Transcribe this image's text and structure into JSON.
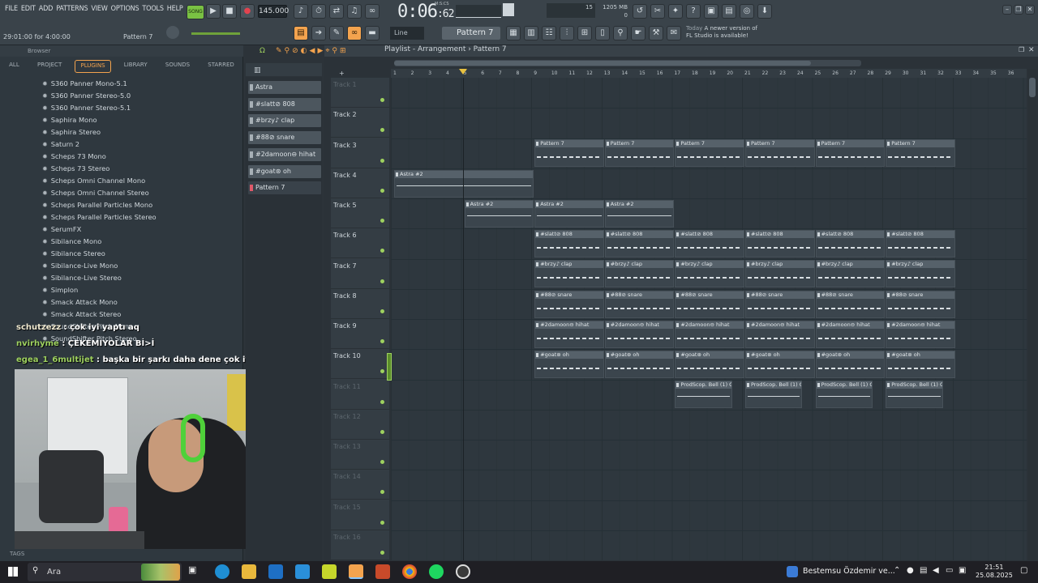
{
  "menu": [
    "FILE",
    "EDIT",
    "ADD",
    "PATTERNS",
    "VIEW",
    "OPTIONS",
    "TOOLS",
    "HELP"
  ],
  "toolbar": {
    "song_label": "SONG",
    "bpm": "145.000",
    "time_main": "0:06",
    "time_sub": ":62",
    "mics_label": "M:S:CS",
    "cpu": "15",
    "memory": "1205 MB",
    "memory2": "0",
    "hint_left": "29:01:00 for 4:00:00",
    "hint_right": "Pattern 7",
    "snap": "Line",
    "pattern": "Pattern 7",
    "news_title": "Today",
    "news_line1": "A newer version of",
    "news_line2": "FL Studio is available!"
  },
  "browser": {
    "title": "Browser",
    "tabs": [
      "ALL",
      "PROJECT",
      "PLUGINS",
      "LIBRARY",
      "SOUNDS",
      "STARRED"
    ],
    "active_tab": "PLUGINS",
    "plugins": [
      "S360 Panner Mono-5.1",
      "S360 Panner Stereo-5.0",
      "S360 Panner Stereo-5.1",
      "Saphira Mono",
      "Saphira Stereo",
      "Saturn 2",
      "Scheps 73 Mono",
      "Scheps 73 Stereo",
      "Scheps Omni Channel Mono",
      "Scheps Omni Channel Stereo",
      "Scheps Parallel Particles Mono",
      "Scheps Parallel Particles Stereo",
      "SerumFX",
      "Sibilance Mono",
      "Sibilance Stereo",
      "Sibilance-Live Mono",
      "Sibilance-Live Stereo",
      "Simplon",
      "Smack Attack Mono",
      "Smack Attack Stereo",
      "SoundShifter Pitch Mono",
      "SoundShifter Pitch Stereo"
    ],
    "tags_label": "TAGS"
  },
  "chat": [
    {
      "user": "schutzezz",
      "msg": " : çok iyi yaptı aq"
    },
    {
      "user": "nvirhyme",
      "msg": " : ÇEKEMIYOLAR Bİ>İ"
    },
    {
      "user": "egea_1_6multijet",
      "msg": " : başka bir şarkı daha dene çok iyi oluyo"
    }
  ],
  "patterns": [
    "Astra",
    "#slatt⊘ 808",
    "#brzy♪ clap",
    "#88⊘ snare",
    "#2damoon⊖ hihat",
    "#goat⊛ oh",
    "Pattern 7"
  ],
  "playlist": {
    "title": "Playlist - Arrangement › Pattern 7",
    "tracks": [
      "Track 1",
      "Track 2",
      "Track 3",
      "Track 4",
      "Track 5",
      "Track 6",
      "Track 7",
      "Track 8",
      "Track 9",
      "Track 10",
      "Track 11",
      "Track 12",
      "Track 13",
      "Track 14",
      "Track 15",
      "Track 16"
    ],
    "bars": [
      "1",
      "2",
      "3",
      "4",
      "5",
      "6",
      "7",
      "8",
      "9",
      "10",
      "11",
      "12",
      "13",
      "14",
      "15",
      "16",
      "17",
      "18",
      "19",
      "20",
      "21",
      "22",
      "23",
      "24",
      "25",
      "26",
      "27",
      "28",
      "29",
      "30",
      "31",
      "32",
      "33",
      "34",
      "35",
      "36"
    ],
    "clips": [
      {
        "label": "Pattern 7",
        "track": 2,
        "bar": 9,
        "len": 4
      },
      {
        "label": "Pattern 7",
        "track": 2,
        "bar": 13,
        "len": 4
      },
      {
        "label": "Pattern 7",
        "track": 2,
        "bar": 17,
        "len": 4
      },
      {
        "label": "Pattern 7",
        "track": 2,
        "bar": 21,
        "len": 4
      },
      {
        "label": "Pattern 7",
        "track": 2,
        "bar": 25,
        "len": 4
      },
      {
        "label": "Pattern 7",
        "track": 2,
        "bar": 29,
        "len": 4
      },
      {
        "label": "Astra #2",
        "track": 3,
        "bar": 1,
        "len": 8,
        "audio": true
      },
      {
        "label": "Astra #2",
        "track": 4,
        "bar": 5,
        "len": 4,
        "audio": true
      },
      {
        "label": "Astra #2",
        "track": 4,
        "bar": 9,
        "len": 4,
        "audio": true
      },
      {
        "label": "Astra #2",
        "track": 4,
        "bar": 13,
        "len": 4,
        "audio": true
      },
      {
        "label": "#slatt⊘ 808",
        "track": 5,
        "bar": 9,
        "len": 4
      },
      {
        "label": "#slatt⊘ 808",
        "track": 5,
        "bar": 13,
        "len": 4
      },
      {
        "label": "#slatt⊘ 808",
        "track": 5,
        "bar": 17,
        "len": 4
      },
      {
        "label": "#slatt⊘ 808",
        "track": 5,
        "bar": 21,
        "len": 4
      },
      {
        "label": "#slatt⊘ 808",
        "track": 5,
        "bar": 25,
        "len": 4
      },
      {
        "label": "#slatt⊘ 808",
        "track": 5,
        "bar": 29,
        "len": 4
      },
      {
        "label": "#brzy♪ clap",
        "track": 6,
        "bar": 9,
        "len": 4
      },
      {
        "label": "#brzy♪ clap",
        "track": 6,
        "bar": 13,
        "len": 4
      },
      {
        "label": "#brzy♪ clap",
        "track": 6,
        "bar": 17,
        "len": 4
      },
      {
        "label": "#brzy♪ clap",
        "track": 6,
        "bar": 21,
        "len": 4
      },
      {
        "label": "#brzy♪ clap",
        "track": 6,
        "bar": 25,
        "len": 4
      },
      {
        "label": "#brzy♪ clap",
        "track": 6,
        "bar": 29,
        "len": 4
      },
      {
        "label": "#88⊘ snare",
        "track": 7,
        "bar": 9,
        "len": 4
      },
      {
        "label": "#88⊘ snare",
        "track": 7,
        "bar": 13,
        "len": 4
      },
      {
        "label": "#88⊘ snare",
        "track": 7,
        "bar": 17,
        "len": 4
      },
      {
        "label": "#88⊘ snare",
        "track": 7,
        "bar": 21,
        "len": 4
      },
      {
        "label": "#88⊘ snare",
        "track": 7,
        "bar": 25,
        "len": 4
      },
      {
        "label": "#88⊘ snare",
        "track": 7,
        "bar": 29,
        "len": 4
      },
      {
        "label": "#2damoon⊖ hihat",
        "track": 8,
        "bar": 9,
        "len": 4
      },
      {
        "label": "#2damoon⊖ hihat",
        "track": 8,
        "bar": 13,
        "len": 4
      },
      {
        "label": "#2damoon⊖ hihat",
        "track": 8,
        "bar": 17,
        "len": 4
      },
      {
        "label": "#2damoon⊖ hihat",
        "track": 8,
        "bar": 21,
        "len": 4
      },
      {
        "label": "#2damoon⊖ hihat",
        "track": 8,
        "bar": 25,
        "len": 4
      },
      {
        "label": "#2damoon⊖ hihat",
        "track": 8,
        "bar": 29,
        "len": 4
      },
      {
        "label": "#goat⊛ oh",
        "track": 9,
        "bar": 9,
        "len": 4
      },
      {
        "label": "#goat⊛ oh",
        "track": 9,
        "bar": 13,
        "len": 4
      },
      {
        "label": "#goat⊛ oh",
        "track": 9,
        "bar": 17,
        "len": 4
      },
      {
        "label": "#goat⊛ oh",
        "track": 9,
        "bar": 21,
        "len": 4
      },
      {
        "label": "#goat⊛ oh",
        "track": 9,
        "bar": 25,
        "len": 4
      },
      {
        "label": "#goat⊛ oh",
        "track": 9,
        "bar": 29,
        "len": 4
      },
      {
        "label": "ProdScop. Bell (1) C",
        "track": 10,
        "bar": 17,
        "len": 3.3,
        "audio": true
      },
      {
        "label": "ProdScop. Bell (1) C",
        "track": 10,
        "bar": 21,
        "len": 3.3,
        "audio": true
      },
      {
        "label": "ProdScop. Bell (1) C",
        "track": 10,
        "bar": 25,
        "len": 3.3,
        "audio": true
      },
      {
        "label": "ProdScop. Bell (1) C",
        "track": 10,
        "bar": 29,
        "len": 3.3,
        "audio": true
      }
    ]
  },
  "taskbar": {
    "search_placeholder": "Ara",
    "media_title": "Bestemsu Özdemir ve...",
    "time": "21:51",
    "date": "25.08.2025"
  },
  "colors": {
    "accent": "#f3a34e",
    "clip": "#56616a",
    "track_dot": "#9ed15f"
  }
}
